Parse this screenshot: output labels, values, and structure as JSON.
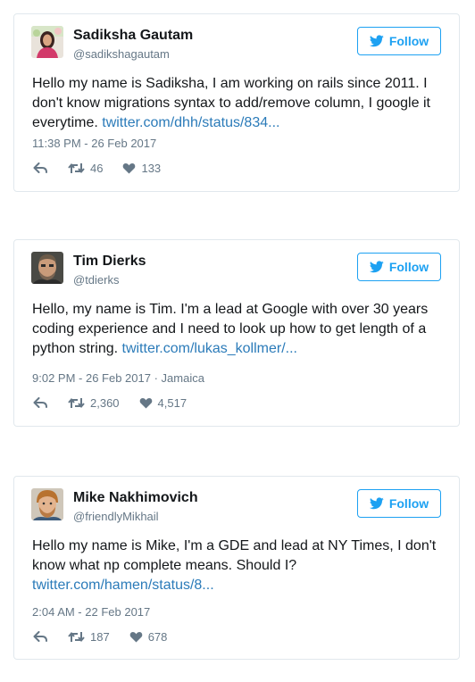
{
  "tweets": [
    {
      "name": "Sadiksha Gautam",
      "handle": "@sadikshagautam",
      "follow_label": "Follow",
      "text": "Hello my name is Sadiksha, I am working on rails since 2011. I don't know migrations syntax to add/remove column, I google it everytime. ",
      "link": "twitter.com/dhh/status/834...",
      "timestamp": "11:38 PM - 26 Feb 2017",
      "retweets": "46",
      "likes": "133"
    },
    {
      "name": "Tim Dierks",
      "handle": "@tdierks",
      "follow_label": "Follow",
      "text": "Hello, my name is Tim. I'm a lead at Google with over 30 years coding experience and I need to look up how to get length of a python string. ",
      "link": "twitter.com/lukas_kollmer/...",
      "timestamp": "9:02 PM - 26 Feb 2017 · Jamaica",
      "retweets": "2,360",
      "likes": "4,517"
    },
    {
      "name": "Mike Nakhimovich",
      "handle": "@friendlyMikhail",
      "follow_label": "Follow",
      "text": "Hello my name is Mike, I'm a GDE and lead at NY Times, I don't know what np complete means. Should I? ",
      "link": "twitter.com/hamen/status/8...",
      "timestamp": "2:04 AM - 22 Feb 2017",
      "retweets": "187",
      "likes": "678"
    }
  ],
  "icons": {
    "follow": "twitter-bird-icon",
    "reply": "reply-icon",
    "retweet": "retweet-icon",
    "like": "heart-icon"
  },
  "colors": {
    "accent": "#1da1f2",
    "link": "#2b7bb9",
    "muted": "#657786",
    "border": "#e1e8ed"
  }
}
